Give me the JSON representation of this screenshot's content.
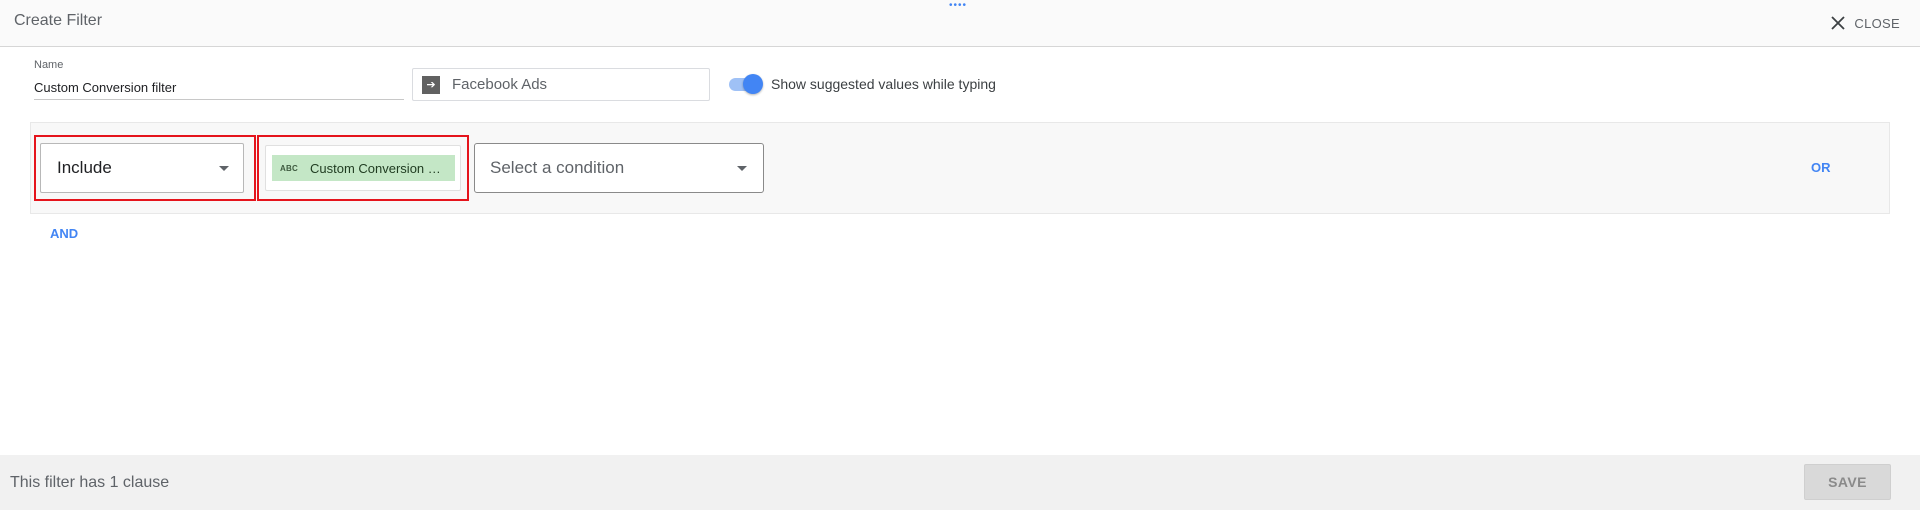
{
  "header": {
    "title": "Create Filter",
    "drag_handle": "••••",
    "close_label": "CLOSE"
  },
  "form": {
    "name_label": "Name",
    "name_value": "Custom Conversion filter",
    "data_source": "Facebook Ads",
    "data_source_icon": "arrow-right-icon",
    "suggest_toggle_label": "Show suggested values while typing",
    "suggest_toggle_on": true
  },
  "clause": {
    "include_value": "Include",
    "field_type": "ABC",
    "field_name": "Custom Conversion N...",
    "condition_placeholder": "Select a condition",
    "or_label": "OR",
    "and_label": "AND"
  },
  "footer": {
    "status": "This filter has 1 clause",
    "save_label": "SAVE"
  },
  "colors": {
    "accent": "#4285f4",
    "highlight": "#e5141c",
    "chip": "#c4e7c6"
  }
}
